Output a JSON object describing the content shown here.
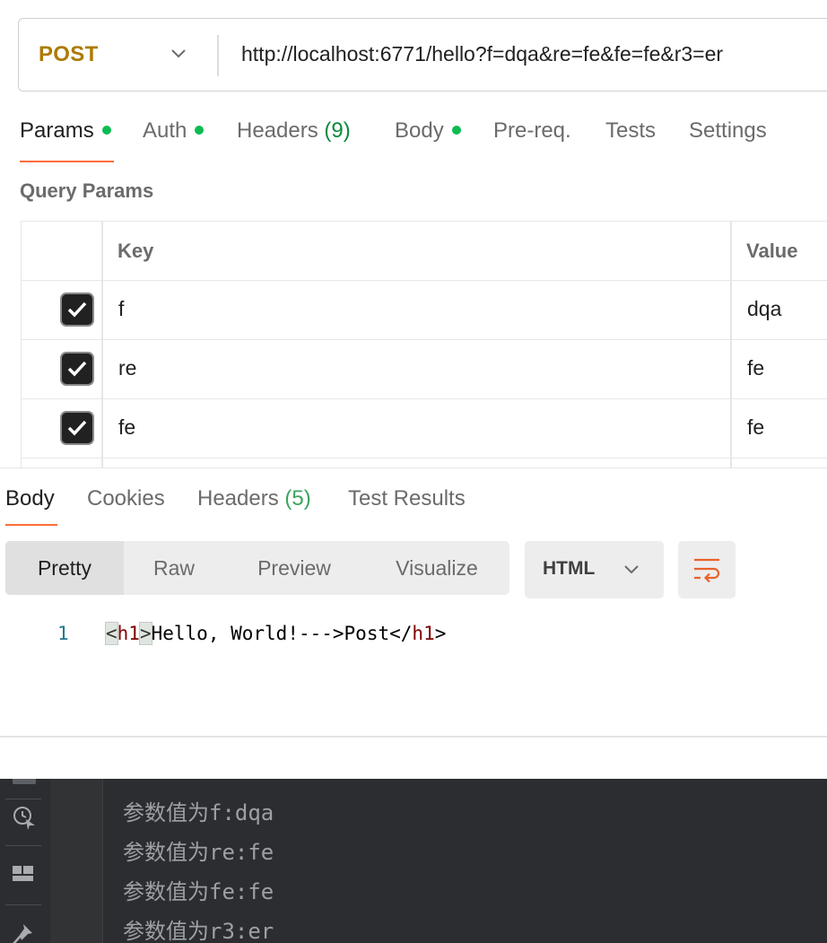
{
  "request": {
    "method": "POST",
    "url": "http://localhost:6771/hello?f=dqa&re=fe&fe=fe&r3=er"
  },
  "request_tabs": [
    {
      "label": "Params",
      "dot": true,
      "active": true
    },
    {
      "label": "Auth",
      "dot": true
    },
    {
      "label": "Headers",
      "count": "(9)"
    },
    {
      "label": "Body",
      "dot": true
    },
    {
      "label": "Pre-req."
    },
    {
      "label": "Tests"
    },
    {
      "label": "Settings"
    }
  ],
  "query_params": {
    "title": "Query Params",
    "headers": {
      "key": "Key",
      "value": "Value"
    },
    "rows": [
      {
        "checked": true,
        "key": "f",
        "value": "dqa"
      },
      {
        "checked": true,
        "key": "re",
        "value": "fe"
      },
      {
        "checked": true,
        "key": "fe",
        "value": "fe"
      }
    ]
  },
  "response": {
    "tabs": [
      {
        "label": "Body",
        "active": true
      },
      {
        "label": "Cookies"
      },
      {
        "label": "Headers",
        "count": "(5)"
      },
      {
        "label": "Test Results"
      }
    ],
    "views": [
      "Pretty",
      "Raw",
      "Preview",
      "Visualize"
    ],
    "active_view": "Pretty",
    "format": "HTML",
    "code": {
      "line_number": "1",
      "open_lt": "<",
      "open_tag": "h1",
      "open_gt": ">",
      "text": "Hello, World!--->Post",
      "close_lt": "</",
      "close_tag": "h1",
      "close_gt": ">"
    }
  },
  "console": {
    "lines": [
      "参数值为f:dqa",
      "参数值为re:fe",
      "参数值为fe:fe",
      "参数值为r3:er"
    ]
  },
  "colors": {
    "method": "#ad7a03",
    "accent": "#ff6c37",
    "status_dot": "#0cbb52",
    "console_bg": "#2b2d30"
  },
  "icons": [
    "chevron-down-icon",
    "checkbox-checked-icon",
    "wrap-lines-icon",
    "history-icon",
    "layout-icon",
    "pin-icon"
  ]
}
